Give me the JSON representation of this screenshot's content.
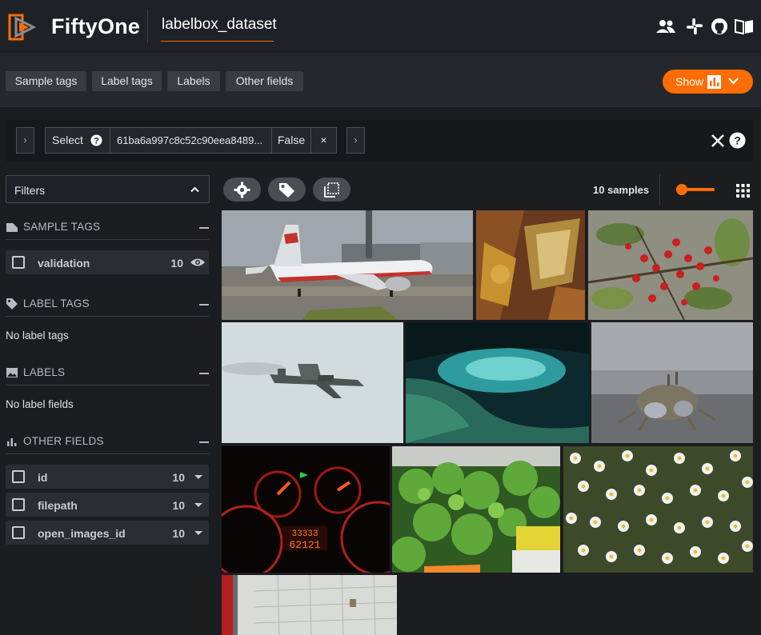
{
  "header": {
    "brand": "FiftyOne",
    "dataset_name": "labelbox_dataset",
    "icons": [
      "users-icon",
      "slack-icon",
      "github-icon",
      "docs-icon"
    ]
  },
  "toolbar": {
    "tabs": [
      "Sample tags",
      "Label tags",
      "Labels",
      "Other fields"
    ],
    "show_label": "Show",
    "accent": "#ff6d04"
  },
  "view_bar": {
    "stage_name": "Select",
    "stage_value": "61ba6a997c8c52c90eea8489,...",
    "stage_value_display": "61ba6a997c8c52c90eea8489...",
    "ordered": "False",
    "remove_label": "×"
  },
  "sidebar": {
    "filters_label": "Filters",
    "sections": {
      "sample_tags": {
        "title": "SAMPLE TAGS",
        "rows": [
          {
            "name": "validation",
            "count": "10"
          }
        ]
      },
      "label_tags": {
        "title": "LABEL TAGS",
        "empty": "No label tags"
      },
      "labels": {
        "title": "LABELS",
        "empty": "No label fields"
      },
      "other_fields": {
        "title": "OTHER FIELDS",
        "rows": [
          {
            "name": "id",
            "count": "10"
          },
          {
            "name": "filepath",
            "count": "10"
          },
          {
            "name": "open_images_id",
            "count": "10"
          }
        ]
      }
    }
  },
  "grid": {
    "samples_label": "10 samples",
    "tiles": [
      "airplane-on-tarmac",
      "golden-textured-frame",
      "red-berries-on-branch",
      "military-jet-in-flight",
      "underwater-cave",
      "crab-on-sand",
      "car-dashboard-gauges",
      "green-leafy-vegetables",
      "field-of-daisies",
      "paper-sheet-closeup"
    ]
  }
}
